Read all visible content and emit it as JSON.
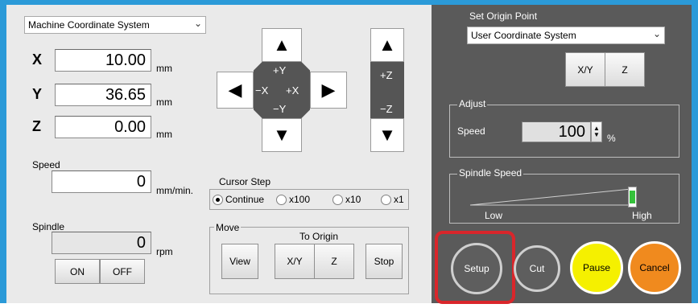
{
  "coordinate_system": {
    "selected": "Machine Coordinate System"
  },
  "position": {
    "x": {
      "label": "X",
      "value": "10.00",
      "unit": "mm"
    },
    "y": {
      "label": "Y",
      "value": "36.65",
      "unit": "mm"
    },
    "z": {
      "label": "Z",
      "value": "0.00",
      "unit": "mm"
    }
  },
  "speed": {
    "label": "Speed",
    "value": "0",
    "unit": "mm/min."
  },
  "spindle": {
    "label": "Spindle",
    "value": "0",
    "unit": "rpm",
    "on_label": "ON",
    "off_label": "OFF"
  },
  "jog": {
    "plus_y": "+Y",
    "minus_y": "−Y",
    "minus_x": "−X",
    "plus_x": "+X",
    "plus_z": "+Z",
    "minus_z": "−Z"
  },
  "cursor_step": {
    "title": "Cursor Step",
    "options": [
      "Continue",
      "x100",
      "x10",
      "x1"
    ],
    "selected": "Continue"
  },
  "move": {
    "title": "Move",
    "to_origin_label": "To Origin",
    "view_label": "View",
    "xy_label": "X/Y",
    "z_label": "Z",
    "stop_label": "Stop"
  },
  "set_origin": {
    "title": "Set Origin Point",
    "selected": "User Coordinate System",
    "xy_label": "X/Y",
    "z_label": "Z"
  },
  "adjust": {
    "title": "Adjust",
    "speed_label": "Speed",
    "speed_value": "100",
    "speed_unit": "%"
  },
  "spindle_speed": {
    "title": "Spindle Speed",
    "low_label": "Low",
    "high_label": "High",
    "level": 1.0
  },
  "actions": {
    "setup_label": "Setup",
    "cut_label": "Cut",
    "pause_label": "Pause",
    "cancel_label": "Cancel"
  },
  "colors": {
    "frame_blue": "#2b9ad8",
    "highlight_red": "#d9262b",
    "pause_yellow": "#f5f000",
    "cancel_orange": "#f08a1e",
    "slider_green": "#35c23b"
  }
}
